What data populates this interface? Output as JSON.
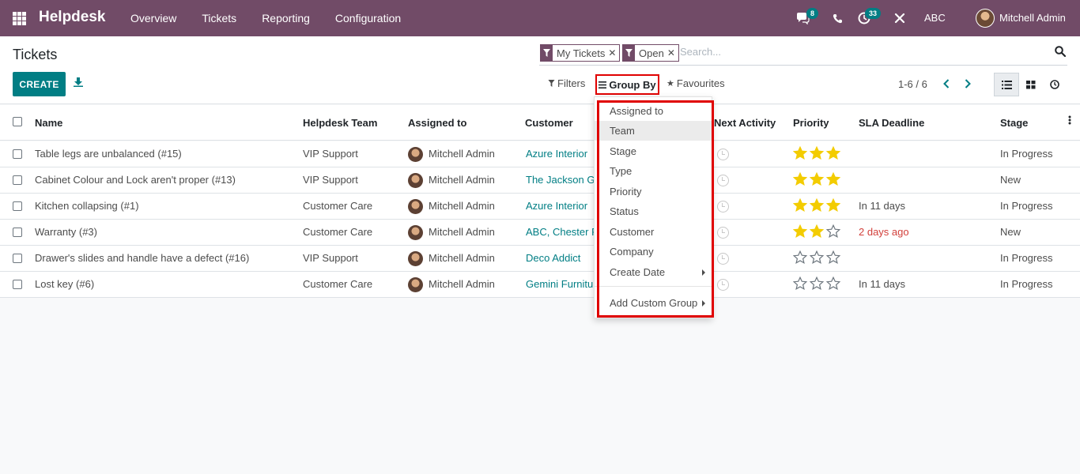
{
  "navbar": {
    "app_name": "Helpdesk",
    "menu": [
      "Overview",
      "Tickets",
      "Reporting",
      "Configuration"
    ],
    "messages_count": "8",
    "activities_count": "33",
    "company": "ABC",
    "user_name": "Mitchell Admin",
    "brand_color": "#714b67",
    "badge_color": "#017e84"
  },
  "control_panel": {
    "title": "Tickets",
    "create_label": "CREATE",
    "facets": [
      "My Tickets",
      "Open"
    ],
    "search_placeholder": "Search...",
    "filters_label": "Filters",
    "group_by_label": "Group By",
    "favourites_label": "Favourites",
    "pager": "1-6 / 6",
    "accent_color": "#017e84",
    "highlight_color": "#e00000"
  },
  "table": {
    "columns": [
      "Name",
      "Helpdesk Team",
      "Assigned to",
      "Customer",
      "Next Activity",
      "Priority",
      "SLA Deadline",
      "Stage"
    ],
    "rows": [
      {
        "name": "Table legs are unbalanced (#15)",
        "team": "VIP Support",
        "assigned": "Mitchell Admin",
        "customer": "Azure Interior",
        "priority": 3,
        "sla": "",
        "sla_overdue": false,
        "stage": "In Progress"
      },
      {
        "name": "Cabinet Colour and Lock aren't proper (#13)",
        "team": "VIP Support",
        "assigned": "Mitchell Admin",
        "customer": "The Jackson G",
        "priority": 3,
        "sla": "",
        "sla_overdue": false,
        "stage": "New"
      },
      {
        "name": "Kitchen collapsing (#1)",
        "team": "Customer Care",
        "assigned": "Mitchell Admin",
        "customer": "Azure Interior",
        "priority": 3,
        "sla": "In 11 days",
        "sla_overdue": false,
        "stage": "In Progress"
      },
      {
        "name": "Warranty (#3)",
        "team": "Customer Care",
        "assigned": "Mitchell Admin",
        "customer": "ABC, Chester R",
        "priority": 2,
        "sla": "2 days ago",
        "sla_overdue": true,
        "stage": "New"
      },
      {
        "name": "Drawer's slides and handle have a defect (#16)",
        "team": "VIP Support",
        "assigned": "Mitchell Admin",
        "customer": "Deco Addict",
        "priority": 0,
        "sla": "",
        "sla_overdue": false,
        "stage": "In Progress"
      },
      {
        "name": "Lost key (#6)",
        "team": "Customer Care",
        "assigned": "Mitchell Admin",
        "customer": "Gemini Furnitu",
        "priority": 0,
        "sla": "In 11 days",
        "sla_overdue": false,
        "stage": "In Progress"
      }
    ]
  },
  "group_by_menu": {
    "items": [
      "Assigned to",
      "Team",
      "Stage",
      "Type",
      "Priority",
      "Status",
      "Customer",
      "Company",
      "Create Date"
    ],
    "hovered": "Team",
    "custom_group_label": "Add Custom Group"
  }
}
